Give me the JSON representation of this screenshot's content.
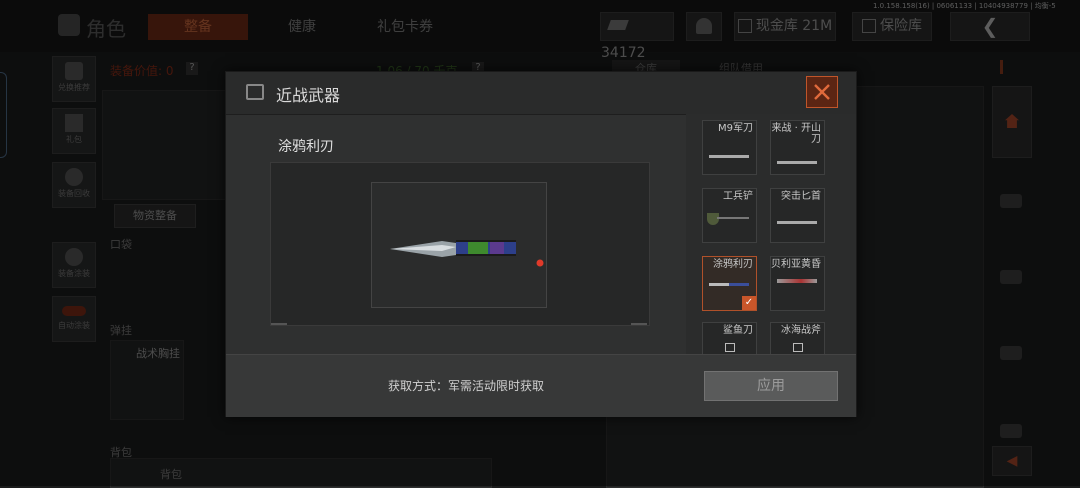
{
  "version_text": "1.0.158.158(16) | 06061133 | 10404938779 | 均衡-5",
  "top": {
    "section_title": "角色",
    "tabs": [
      "整备",
      "健康",
      "礼包卡券"
    ],
    "currency_value": "34172",
    "cash_label": "现金库 21M",
    "safe_label": "保险库"
  },
  "left_panel": {
    "equip_value_label": "装备价值: 0",
    "capacity_text": "1.06 / 70 千克",
    "supply_button": "物资整备",
    "pocket_label": "口袋",
    "vest_label": "弹挂",
    "vest_item": "战术胸挂",
    "backpack_label": "背包",
    "backpack_item": "背包",
    "side_items": [
      "兑换推荐",
      "礼包",
      "装备回收",
      "装备涂装",
      "自动涂装"
    ]
  },
  "right_panel": {
    "tabs": [
      "仓库",
      "组队借用"
    ]
  },
  "modal": {
    "title": "近战武器",
    "weapon_name": "涂鸦利刃",
    "acquire_text": "获取方式：军需活动限时获取",
    "apply_label": "应用",
    "items": [
      {
        "name": "M9军刀",
        "locked": false,
        "selected": false
      },
      {
        "name": "来战 · 开山刀",
        "locked": false,
        "selected": false
      },
      {
        "name": "工兵铲",
        "locked": false,
        "selected": false
      },
      {
        "name": "突击匕首",
        "locked": false,
        "selected": false
      },
      {
        "name": "涂鸦利刃",
        "locked": false,
        "selected": true
      },
      {
        "name": "贝利亚黄昏",
        "locked": false,
        "selected": false
      },
      {
        "name": "鲨鱼刀",
        "locked": true,
        "selected": false
      },
      {
        "name": "冰海战斧",
        "locked": true,
        "selected": false
      }
    ]
  },
  "colors": {
    "accent": "#c9562a",
    "modal_bg": "#2f3030"
  }
}
